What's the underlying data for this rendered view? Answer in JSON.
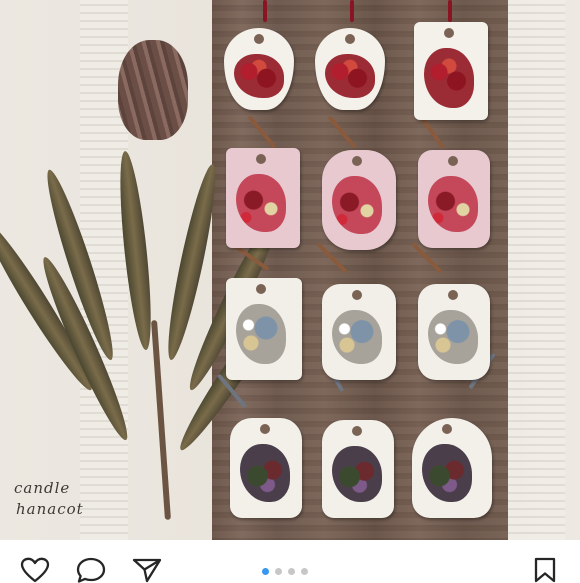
{
  "post": {
    "watermark_line1": "candle",
    "watermark_line2": "hanacot",
    "carousel": {
      "total_slides": 4,
      "active_slide": 1
    }
  },
  "actions": {
    "like_icon": "heart-outline-icon",
    "comment_icon": "comment-bubble-icon",
    "share_icon": "paper-plane-icon",
    "save_icon": "bookmark-icon"
  },
  "colors": {
    "accent": "#3897f0",
    "inactive_dot": "#c7c7c7",
    "icon": "#262626"
  }
}
